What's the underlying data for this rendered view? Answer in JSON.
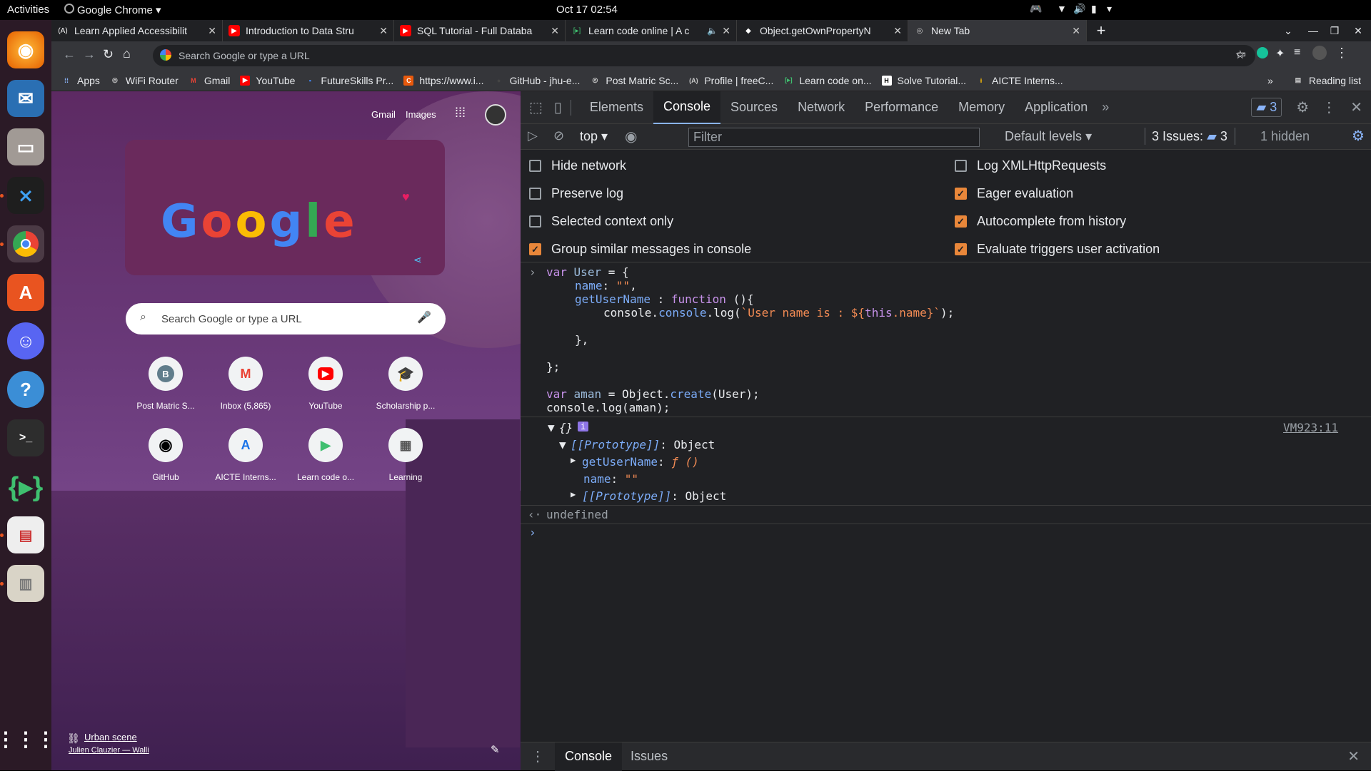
{
  "topbar": {
    "activities": "Activities",
    "app": "Google Chrome ▾",
    "datetime": "Oct 17  02:54"
  },
  "tabs": [
    {
      "title": "Learn Applied Accessibilit",
      "favicon": "(A)"
    },
    {
      "title": "Introduction to Data Stru",
      "favicon": "▶"
    },
    {
      "title": "SQL Tutorial - Full Databa",
      "favicon": "▶"
    },
    {
      "title": "Learn code online | A c",
      "favicon": "[▸]"
    },
    {
      "title": "Object.getOwnPropertyN",
      "favicon": "◆"
    },
    {
      "title": "New Tab",
      "favicon": "◎"
    }
  ],
  "omnibox": {
    "placeholder": "Search Google or type a URL"
  },
  "bookmarks": [
    "Apps",
    "WiFi Router",
    "Gmail",
    "YouTube",
    "FutureSkills Pr...",
    "https://www.i...",
    "GitHub - jhu-e...",
    "Post Matric Sc...",
    "Profile | freeC...",
    "Learn code on...",
    "Solve Tutorial...",
    "AICTE Interns..."
  ],
  "reading_list": "Reading list",
  "ntp": {
    "gmail": "Gmail",
    "images": "Images",
    "search_placeholder": "Search Google or type a URL",
    "shortcuts": [
      {
        "label": "Post Matric S...",
        "icon": "B"
      },
      {
        "label": "Inbox (5,865)",
        "icon": "M"
      },
      {
        "label": "YouTube",
        "icon": "▶"
      },
      {
        "label": "Scholarship p...",
        "icon": "🎓"
      },
      {
        "label": "GitHub",
        "icon": "◉"
      },
      {
        "label": "AICTE Interns...",
        "icon": "A"
      },
      {
        "label": "Learn code o...",
        "icon": "▶"
      },
      {
        "label": "Learning",
        "icon": "▦"
      }
    ],
    "credit_title": "Urban scene",
    "credit_author": "Julien Clauzier — Walli"
  },
  "devtools": {
    "tabs": [
      "Elements",
      "Console",
      "Sources",
      "Network",
      "Performance",
      "Memory",
      "Application"
    ],
    "issues_badge": "3",
    "context": "top",
    "filter_placeholder": "Filter",
    "levels": "Default levels",
    "issues_label": "3 Issues:",
    "issues_count": "3",
    "hidden": "1 hidden",
    "options_left": [
      {
        "label": "Hide network",
        "checked": false
      },
      {
        "label": "Preserve log",
        "checked": false
      },
      {
        "label": "Selected context only",
        "checked": false
      },
      {
        "label": "Group similar messages in console",
        "checked": true
      }
    ],
    "options_right": [
      {
        "label": "Log XMLHttpRequests",
        "checked": false
      },
      {
        "label": "Eager evaluation",
        "checked": true
      },
      {
        "label": "Autocomplete from history",
        "checked": true
      },
      {
        "label": "Evaluate triggers user activation",
        "checked": true
      }
    ],
    "console": {
      "code": {
        "l1_kw": "var",
        "l1_var": "User",
        "l1_rest": " = {",
        "l2_prop": "name",
        "l2_colon": ": ",
        "l2_str": "\"\"",
        "l2_end": ",",
        "l3_prop": "getUserName",
        "l3_mid": " : ",
        "l3_kw": "function",
        "l3_end": " (){",
        "l4_pre": "console.",
        "l4_prop": "console",
        "l4_mid": ".log(",
        "l4_t1": "`User name is : ${",
        "l4_this": "this",
        "l4_t2": ".name}`",
        "l4_end": ");",
        "l5": "},",
        "l6": "};",
        "l7_kw": "var",
        "l7_var": "aman",
        "l7_mid": " = Object.",
        "l7_fn": "create",
        "l7_end": "(User);",
        "l8": "console.log(aman);"
      },
      "obj_summary": "{}",
      "obj_info": "i",
      "source_link": "VM923:11",
      "proto_key": "[[Prototype]]",
      "proto_val": ": Object",
      "method_key": "getUserName",
      "method_val": "ƒ ()",
      "name_key": "name",
      "name_val": "\"\"",
      "proto2_key": "[[Prototype]]",
      "proto2_val": ": Object",
      "result": "undefined"
    },
    "drawer_tabs": [
      "Console",
      "Issues"
    ]
  }
}
